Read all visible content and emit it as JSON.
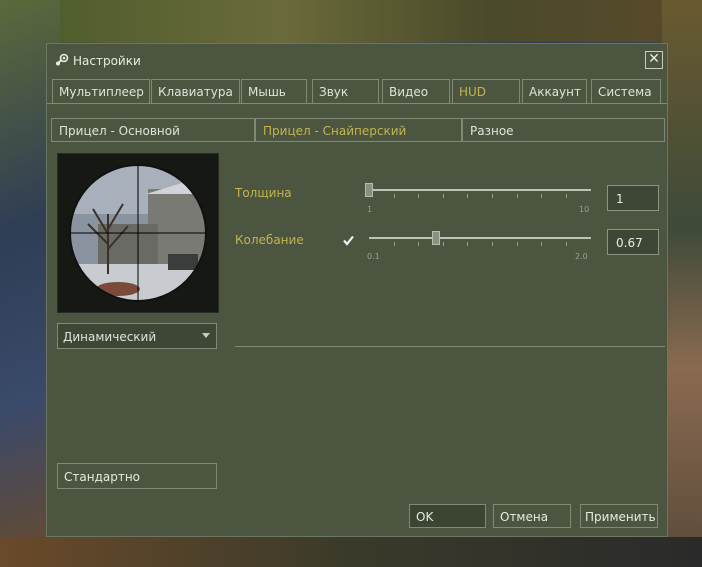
{
  "window": {
    "title": "Настройки",
    "close_glyph": "✕",
    "title_icon": "steam-icon"
  },
  "tabs": [
    {
      "label": "Мультиплеер",
      "active": false
    },
    {
      "label": "Клавиатура",
      "active": false
    },
    {
      "label": "Мышь",
      "active": false
    },
    {
      "label": "Звук",
      "active": false
    },
    {
      "label": "Видео",
      "active": false
    },
    {
      "label": "HUD",
      "active": true
    },
    {
      "label": "Аккаунт",
      "active": false
    },
    {
      "label": "Система",
      "active": false
    }
  ],
  "subtabs": [
    {
      "label": "Прицел - Основной",
      "active": false
    },
    {
      "label": "Прицел - Снайперский",
      "active": true
    },
    {
      "label": "Разное",
      "active": false
    }
  ],
  "crosshair": {
    "style_selected": "Динамический",
    "reset_label": "Стандартно"
  },
  "settings": {
    "thickness": {
      "label": "Толщина",
      "min": "1",
      "max": "10",
      "value": "1",
      "fraction": 0.0
    },
    "sway": {
      "label": "Колебание",
      "checked": true,
      "min": "0.1",
      "max": "2.0",
      "value": "0.67",
      "fraction": 0.3
    }
  },
  "footer": {
    "ok": "OK",
    "cancel": "Отмена",
    "apply": "Применить"
  },
  "colors": {
    "accent": "#c4b550",
    "panel": "#4b5540",
    "border": "#7f8a74"
  }
}
